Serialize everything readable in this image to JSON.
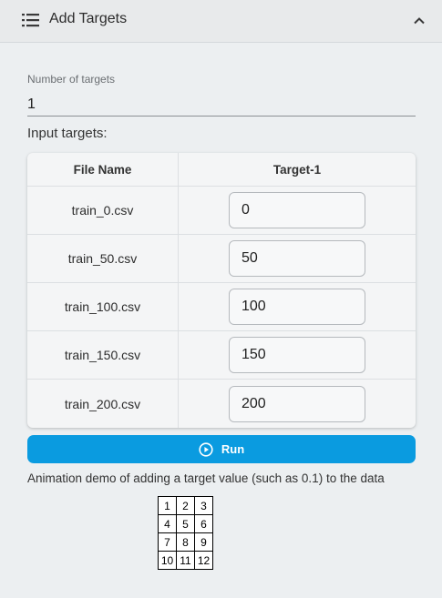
{
  "header": {
    "title": "Add Targets",
    "menu_icon": "list-icon",
    "collapse_icon": "chevron-up-icon"
  },
  "number_of_targets": {
    "label": "Number of targets",
    "value": "1"
  },
  "input_targets_heading": "Input targets:",
  "table": {
    "columns": [
      "File Name",
      "Target-1"
    ],
    "rows": [
      {
        "file": "train_0.csv",
        "target": "0"
      },
      {
        "file": "train_50.csv",
        "target": "50"
      },
      {
        "file": "train_100.csv",
        "target": "100"
      },
      {
        "file": "train_150.csv",
        "target": "150"
      },
      {
        "file": "train_200.csv",
        "target": "200"
      }
    ]
  },
  "run_button": {
    "label": "Run",
    "icon": "play-circle-icon",
    "color": "#0a9be0"
  },
  "caption": "Animation demo of adding a target value (such as 0.1) to the data",
  "demo_grid": [
    [
      "1",
      "2",
      "3"
    ],
    [
      "4",
      "5",
      "6"
    ],
    [
      "7",
      "8",
      "9"
    ],
    [
      "10",
      "11",
      "12"
    ]
  ]
}
